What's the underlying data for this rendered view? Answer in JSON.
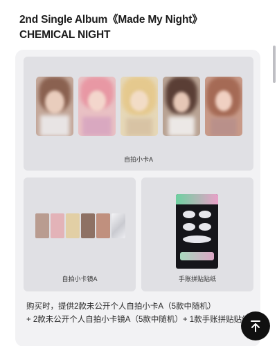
{
  "header": {
    "title_line1": "2nd Single Album《Made My Night》",
    "title_line2": "CHEMICAL NIGHT"
  },
  "cards": [
    {
      "label": "自拍小卡A"
    },
    {
      "label": "自拍小卡镜A"
    },
    {
      "label": "手账拼贴贴纸"
    }
  ],
  "description": {
    "line1": "购买时，提供2款未公开个人自拍小卡A（5款中随机）",
    "line2": "+ 2款未公开个人自拍小卡镜A（5款中随机）+ 1款手账拼贴贴纸。"
  },
  "icons": {
    "scroll_top": "arrow-up-to-top-icon"
  }
}
